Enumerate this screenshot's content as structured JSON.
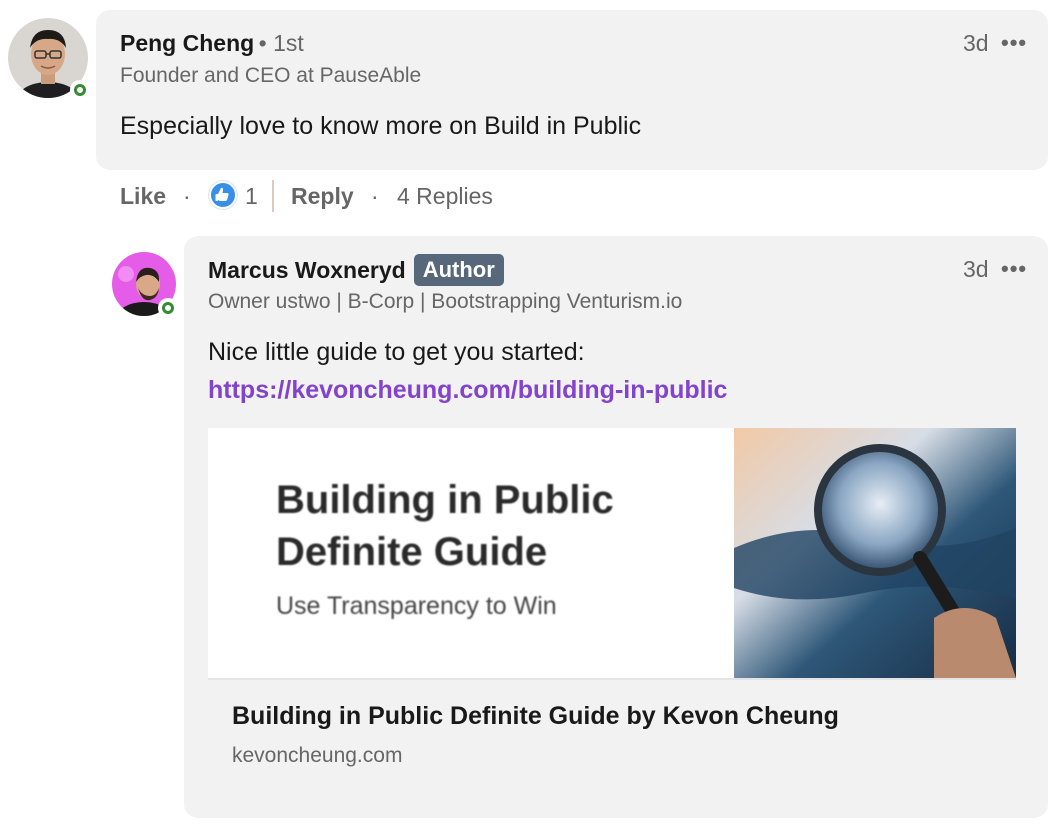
{
  "comment": {
    "author": "Peng Cheng",
    "degree": "• 1st",
    "headline": "Founder and CEO at PauseAble",
    "time": "3d",
    "more": "•••",
    "text": "Especially love to know more on Build in Public",
    "actions": {
      "like": "Like",
      "sep1": "·",
      "reaction_count": "1",
      "reply": "Reply",
      "sep2": "·",
      "replies": "4 Replies"
    }
  },
  "reply": {
    "author": "Marcus Woxneryd",
    "badge": "Author",
    "headline": "Owner ustwo | B-Corp | Bootstrapping Venturism.io",
    "time": "3d",
    "more": "•••",
    "text": "Nice little guide to get you started:",
    "link": "https://kevoncheung.com/building-in-public",
    "card": {
      "image_title_line1": "Building in Public",
      "image_title_line2": "Definite Guide",
      "image_subtitle": "Use Transparency to Win",
      "title": "Building in Public Definite Guide by Kevon Cheung",
      "domain": "kevoncheung.com"
    }
  },
  "colors": {
    "bubble": "#f2f2f2",
    "link": "#8344cc",
    "author_badge": "#56687a",
    "online": "#378a34",
    "like_blue": "#378fe9"
  }
}
